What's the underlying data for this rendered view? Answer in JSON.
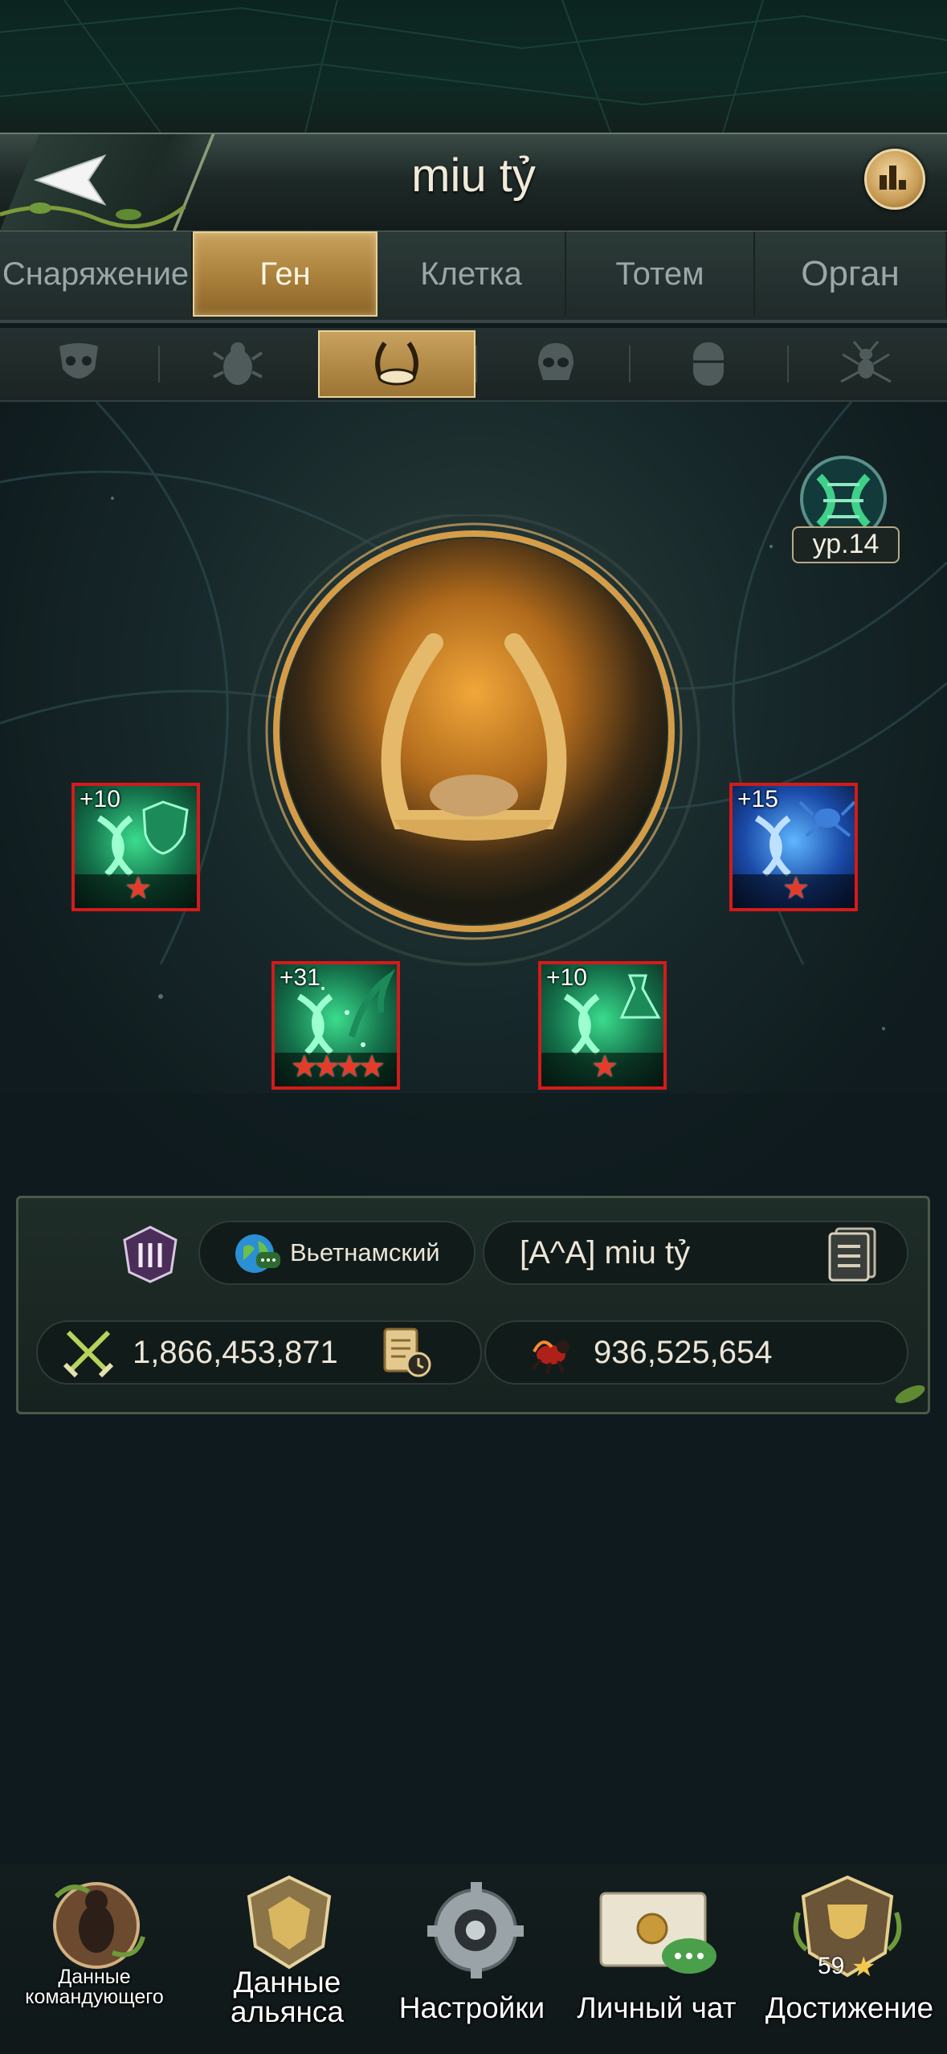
{
  "header": {
    "title": "miu tỷ"
  },
  "tabs": [
    {
      "label": "Снаряжение",
      "active": false
    },
    {
      "label": "Ген",
      "active": true
    },
    {
      "label": "Клетка",
      "active": false
    },
    {
      "label": "Тотем",
      "active": false
    },
    {
      "label": "Орган",
      "active": false
    }
  ],
  "subtabs": [
    {
      "icon": "mask-icon",
      "active": false
    },
    {
      "icon": "beetle-icon",
      "active": false
    },
    {
      "icon": "horns-icon",
      "active": true
    },
    {
      "icon": "skull-icon",
      "active": false
    },
    {
      "icon": "capsule-icon",
      "active": false
    },
    {
      "icon": "ant-icon",
      "active": false
    }
  ],
  "gene_level": {
    "label": "ур.14"
  },
  "genes": [
    {
      "plus": "+10",
      "stars": "★",
      "color": "green",
      "icon": "dna-shield-icon"
    },
    {
      "plus": "+15",
      "stars": "★",
      "color": "blue",
      "icon": "dna-ant-icon"
    },
    {
      "plus": "+31",
      "stars": "★★★★",
      "color": "green",
      "icon": "dna-scythe-icon"
    },
    {
      "plus": "+10",
      "stars": "★",
      "color": "green",
      "icon": "dna-flask-icon"
    }
  ],
  "profile": {
    "language": "Вьетнамский",
    "name": "[A^A]  miu tỷ",
    "power": "1,866,453,871",
    "kills": "936,525,654"
  },
  "nav": [
    {
      "label": "Данные командующего",
      "icon": "commander-icon"
    },
    {
      "label": "Данные альянса",
      "icon": "alliance-icon"
    },
    {
      "label": "Настройки",
      "icon": "gear-icon"
    },
    {
      "label": "Личный чат",
      "icon": "mail-icon"
    },
    {
      "label": "Достижение",
      "icon": "trophy-icon",
      "badge": "59"
    }
  ],
  "colors": {
    "accent": "#c8a15c",
    "gene_border": "#d31b1b",
    "star": "#e63a2a"
  }
}
